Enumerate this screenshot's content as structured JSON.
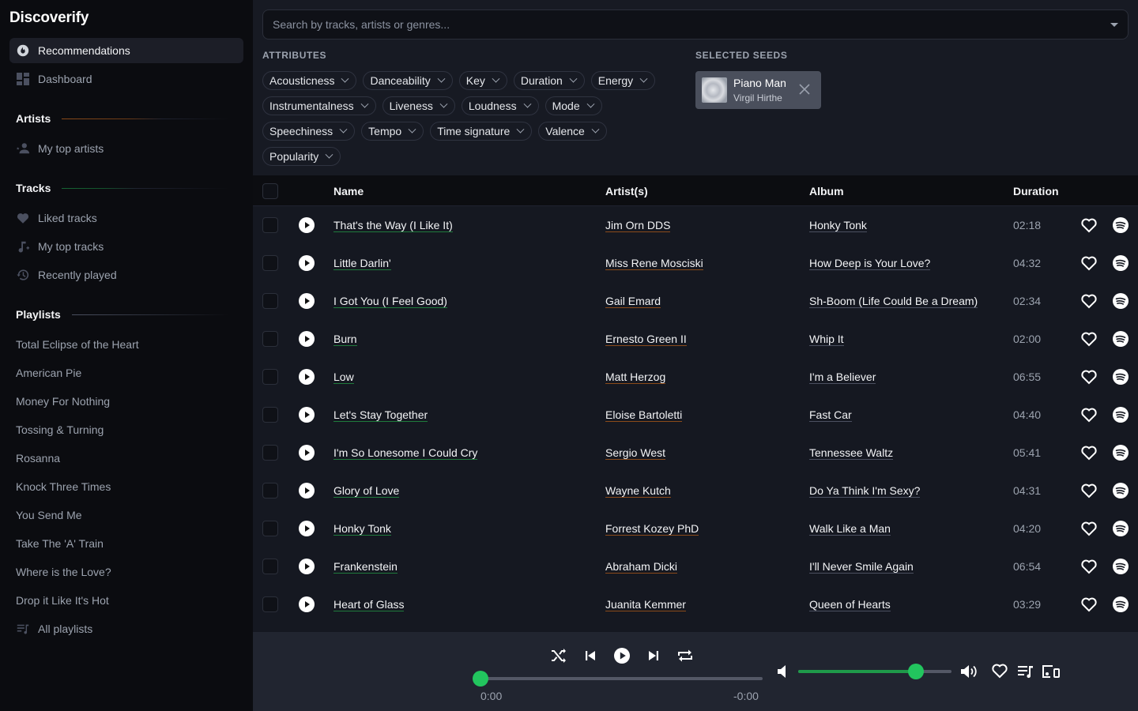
{
  "app": {
    "title": "Discoverify"
  },
  "sidebar": {
    "nav": [
      {
        "label": "Recommendations",
        "icon": "recommendations-icon",
        "active": true
      },
      {
        "label": "Dashboard",
        "icon": "dashboard-icon",
        "active": false
      }
    ],
    "sections": {
      "artists": {
        "title": "Artists",
        "accent": "#b45309",
        "items": [
          {
            "label": "My top artists",
            "icon": "top-artists-icon"
          }
        ]
      },
      "tracks": {
        "title": "Tracks",
        "accent": "#16a34a",
        "items": [
          {
            "label": "Liked tracks",
            "icon": "heart-icon"
          },
          {
            "label": "My top tracks",
            "icon": "music-note-plus-icon"
          },
          {
            "label": "Recently played",
            "icon": "history-icon"
          }
        ]
      },
      "playlists": {
        "title": "Playlists",
        "accent": "#6b7280",
        "items": [
          "Total Eclipse of the Heart",
          "American Pie",
          "Money For Nothing",
          "Tossing & Turning",
          "Rosanna",
          "Knock Three Times",
          "You Send Me",
          "Take The 'A' Train",
          "Where is the Love?",
          "Drop it Like It's Hot"
        ],
        "all_label": "All playlists"
      }
    }
  },
  "search": {
    "placeholder": "Search by tracks, artists or genres...",
    "value": ""
  },
  "attributes": {
    "title": "ATTRIBUTES",
    "items": [
      "Acousticness",
      "Danceability",
      "Key",
      "Duration",
      "Energy",
      "Instrumentalness",
      "Liveness",
      "Loudness",
      "Mode",
      "Speechiness",
      "Tempo",
      "Time signature",
      "Valence",
      "Popularity"
    ]
  },
  "seeds": {
    "title": "SELECTED SEEDS",
    "items": [
      {
        "title": "Piano Man",
        "subtitle": "Virgil Hirthe"
      }
    ]
  },
  "table": {
    "columns": {
      "name": "Name",
      "artist": "Artist(s)",
      "album": "Album",
      "duration": "Duration"
    },
    "rows": [
      {
        "name": "That's the Way (I Like It)",
        "artist": "Jim Orn DDS",
        "album": "Honky Tonk",
        "duration": "02:18"
      },
      {
        "name": "Little Darlin'",
        "artist": "Miss Rene Mosciski",
        "album": "How Deep is Your Love?",
        "duration": "04:32"
      },
      {
        "name": "I Got You (I Feel Good)",
        "artist": "Gail Emard",
        "album": "Sh-Boom (Life Could Be a Dream)",
        "duration": "02:34"
      },
      {
        "name": "Burn",
        "artist": "Ernesto Green II",
        "album": "Whip It",
        "duration": "02:00"
      },
      {
        "name": "Low",
        "artist": "Matt Herzog",
        "album": "I'm a Believer",
        "duration": "06:55"
      },
      {
        "name": "Let's Stay Together",
        "artist": "Eloise Bartoletti",
        "album": "Fast Car",
        "duration": "04:40"
      },
      {
        "name": "I'm So Lonesome I Could Cry",
        "artist": "Sergio West",
        "album": "Tennessee Waltz",
        "duration": "05:41"
      },
      {
        "name": "Glory of Love",
        "artist": "Wayne Kutch",
        "album": "Do Ya Think I'm Sexy?",
        "duration": "04:31"
      },
      {
        "name": "Honky Tonk",
        "artist": "Forrest Kozey PhD",
        "album": "Walk Like a Man",
        "duration": "04:20"
      },
      {
        "name": "Frankenstein",
        "artist": "Abraham Dicki",
        "album": "I'll Never Smile Again",
        "duration": "06:54"
      },
      {
        "name": "Heart of Glass",
        "artist": "Juanita Kemmer",
        "album": "Queen of Hearts",
        "duration": "03:29"
      }
    ]
  },
  "player": {
    "elapsed": "0:00",
    "remaining": "-0:00",
    "progress": 0,
    "volume": 0.77,
    "accent": "#22c55e"
  }
}
